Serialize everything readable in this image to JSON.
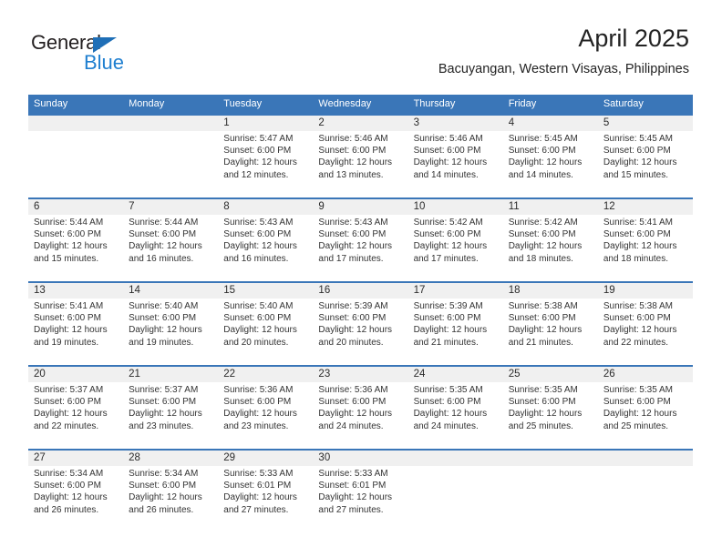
{
  "brand": {
    "name_part1": "General",
    "name_part2": "Blue",
    "triangle_color": "#1f6fb7",
    "blue_color": "#1f7fd0"
  },
  "header": {
    "title": "April 2025",
    "subtitle": "Bacuyangan, Western Visayas, Philippines"
  },
  "theme": {
    "header_blue": "#3a76b8",
    "daynum_band": "#f0f0f0",
    "text": "#333333"
  },
  "weekdays": [
    "Sunday",
    "Monday",
    "Tuesday",
    "Wednesday",
    "Thursday",
    "Friday",
    "Saturday"
  ],
  "weeks": [
    [
      {
        "day": "",
        "sunrise": "",
        "sunset": "",
        "daylight_line1": "",
        "daylight_line2": ""
      },
      {
        "day": "",
        "sunrise": "",
        "sunset": "",
        "daylight_line1": "",
        "daylight_line2": ""
      },
      {
        "day": "1",
        "sunrise": "Sunrise: 5:47 AM",
        "sunset": "Sunset: 6:00 PM",
        "daylight_line1": "Daylight: 12 hours",
        "daylight_line2": "and 12 minutes."
      },
      {
        "day": "2",
        "sunrise": "Sunrise: 5:46 AM",
        "sunset": "Sunset: 6:00 PM",
        "daylight_line1": "Daylight: 12 hours",
        "daylight_line2": "and 13 minutes."
      },
      {
        "day": "3",
        "sunrise": "Sunrise: 5:46 AM",
        "sunset": "Sunset: 6:00 PM",
        "daylight_line1": "Daylight: 12 hours",
        "daylight_line2": "and 14 minutes."
      },
      {
        "day": "4",
        "sunrise": "Sunrise: 5:45 AM",
        "sunset": "Sunset: 6:00 PM",
        "daylight_line1": "Daylight: 12 hours",
        "daylight_line2": "and 14 minutes."
      },
      {
        "day": "5",
        "sunrise": "Sunrise: 5:45 AM",
        "sunset": "Sunset: 6:00 PM",
        "daylight_line1": "Daylight: 12 hours",
        "daylight_line2": "and 15 minutes."
      }
    ],
    [
      {
        "day": "6",
        "sunrise": "Sunrise: 5:44 AM",
        "sunset": "Sunset: 6:00 PM",
        "daylight_line1": "Daylight: 12 hours",
        "daylight_line2": "and 15 minutes."
      },
      {
        "day": "7",
        "sunrise": "Sunrise: 5:44 AM",
        "sunset": "Sunset: 6:00 PM",
        "daylight_line1": "Daylight: 12 hours",
        "daylight_line2": "and 16 minutes."
      },
      {
        "day": "8",
        "sunrise": "Sunrise: 5:43 AM",
        "sunset": "Sunset: 6:00 PM",
        "daylight_line1": "Daylight: 12 hours",
        "daylight_line2": "and 16 minutes."
      },
      {
        "day": "9",
        "sunrise": "Sunrise: 5:43 AM",
        "sunset": "Sunset: 6:00 PM",
        "daylight_line1": "Daylight: 12 hours",
        "daylight_line2": "and 17 minutes."
      },
      {
        "day": "10",
        "sunrise": "Sunrise: 5:42 AM",
        "sunset": "Sunset: 6:00 PM",
        "daylight_line1": "Daylight: 12 hours",
        "daylight_line2": "and 17 minutes."
      },
      {
        "day": "11",
        "sunrise": "Sunrise: 5:42 AM",
        "sunset": "Sunset: 6:00 PM",
        "daylight_line1": "Daylight: 12 hours",
        "daylight_line2": "and 18 minutes."
      },
      {
        "day": "12",
        "sunrise": "Sunrise: 5:41 AM",
        "sunset": "Sunset: 6:00 PM",
        "daylight_line1": "Daylight: 12 hours",
        "daylight_line2": "and 18 minutes."
      }
    ],
    [
      {
        "day": "13",
        "sunrise": "Sunrise: 5:41 AM",
        "sunset": "Sunset: 6:00 PM",
        "daylight_line1": "Daylight: 12 hours",
        "daylight_line2": "and 19 minutes."
      },
      {
        "day": "14",
        "sunrise": "Sunrise: 5:40 AM",
        "sunset": "Sunset: 6:00 PM",
        "daylight_line1": "Daylight: 12 hours",
        "daylight_line2": "and 19 minutes."
      },
      {
        "day": "15",
        "sunrise": "Sunrise: 5:40 AM",
        "sunset": "Sunset: 6:00 PM",
        "daylight_line1": "Daylight: 12 hours",
        "daylight_line2": "and 20 minutes."
      },
      {
        "day": "16",
        "sunrise": "Sunrise: 5:39 AM",
        "sunset": "Sunset: 6:00 PM",
        "daylight_line1": "Daylight: 12 hours",
        "daylight_line2": "and 20 minutes."
      },
      {
        "day": "17",
        "sunrise": "Sunrise: 5:39 AM",
        "sunset": "Sunset: 6:00 PM",
        "daylight_line1": "Daylight: 12 hours",
        "daylight_line2": "and 21 minutes."
      },
      {
        "day": "18",
        "sunrise": "Sunrise: 5:38 AM",
        "sunset": "Sunset: 6:00 PM",
        "daylight_line1": "Daylight: 12 hours",
        "daylight_line2": "and 21 minutes."
      },
      {
        "day": "19",
        "sunrise": "Sunrise: 5:38 AM",
        "sunset": "Sunset: 6:00 PM",
        "daylight_line1": "Daylight: 12 hours",
        "daylight_line2": "and 22 minutes."
      }
    ],
    [
      {
        "day": "20",
        "sunrise": "Sunrise: 5:37 AM",
        "sunset": "Sunset: 6:00 PM",
        "daylight_line1": "Daylight: 12 hours",
        "daylight_line2": "and 22 minutes."
      },
      {
        "day": "21",
        "sunrise": "Sunrise: 5:37 AM",
        "sunset": "Sunset: 6:00 PM",
        "daylight_line1": "Daylight: 12 hours",
        "daylight_line2": "and 23 minutes."
      },
      {
        "day": "22",
        "sunrise": "Sunrise: 5:36 AM",
        "sunset": "Sunset: 6:00 PM",
        "daylight_line1": "Daylight: 12 hours",
        "daylight_line2": "and 23 minutes."
      },
      {
        "day": "23",
        "sunrise": "Sunrise: 5:36 AM",
        "sunset": "Sunset: 6:00 PM",
        "daylight_line1": "Daylight: 12 hours",
        "daylight_line2": "and 24 minutes."
      },
      {
        "day": "24",
        "sunrise": "Sunrise: 5:35 AM",
        "sunset": "Sunset: 6:00 PM",
        "daylight_line1": "Daylight: 12 hours",
        "daylight_line2": "and 24 minutes."
      },
      {
        "day": "25",
        "sunrise": "Sunrise: 5:35 AM",
        "sunset": "Sunset: 6:00 PM",
        "daylight_line1": "Daylight: 12 hours",
        "daylight_line2": "and 25 minutes."
      },
      {
        "day": "26",
        "sunrise": "Sunrise: 5:35 AM",
        "sunset": "Sunset: 6:00 PM",
        "daylight_line1": "Daylight: 12 hours",
        "daylight_line2": "and 25 minutes."
      }
    ],
    [
      {
        "day": "27",
        "sunrise": "Sunrise: 5:34 AM",
        "sunset": "Sunset: 6:00 PM",
        "daylight_line1": "Daylight: 12 hours",
        "daylight_line2": "and 26 minutes."
      },
      {
        "day": "28",
        "sunrise": "Sunrise: 5:34 AM",
        "sunset": "Sunset: 6:00 PM",
        "daylight_line1": "Daylight: 12 hours",
        "daylight_line2": "and 26 minutes."
      },
      {
        "day": "29",
        "sunrise": "Sunrise: 5:33 AM",
        "sunset": "Sunset: 6:01 PM",
        "daylight_line1": "Daylight: 12 hours",
        "daylight_line2": "and 27 minutes."
      },
      {
        "day": "30",
        "sunrise": "Sunrise: 5:33 AM",
        "sunset": "Sunset: 6:01 PM",
        "daylight_line1": "Daylight: 12 hours",
        "daylight_line2": "and 27 minutes."
      },
      {
        "day": "",
        "sunrise": "",
        "sunset": "",
        "daylight_line1": "",
        "daylight_line2": ""
      },
      {
        "day": "",
        "sunrise": "",
        "sunset": "",
        "daylight_line1": "",
        "daylight_line2": ""
      },
      {
        "day": "",
        "sunrise": "",
        "sunset": "",
        "daylight_line1": "",
        "daylight_line2": ""
      }
    ]
  ]
}
